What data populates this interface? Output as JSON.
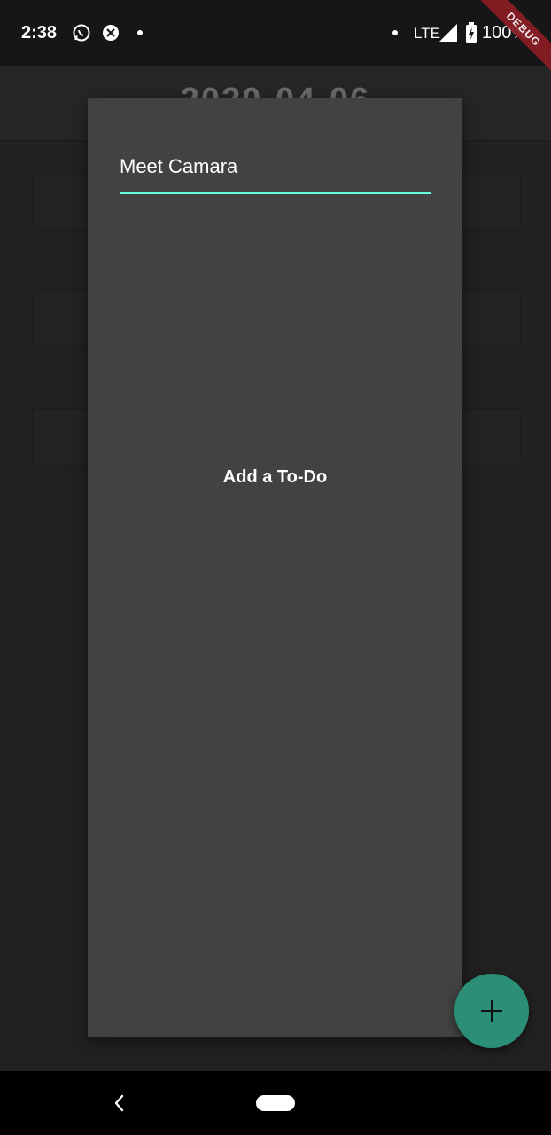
{
  "status_bar": {
    "time": "2:38",
    "network": "LTE",
    "battery": "100%"
  },
  "debug_banner": "DEBUG",
  "background": {
    "title": "2020-04-06"
  },
  "dialog": {
    "input_value": "Meet Camara",
    "action_label": "Add a To-Do",
    "accent_color": "#64ffda"
  },
  "fab": {
    "icon": "plus-icon",
    "color": "#2b8f78"
  },
  "nav": {
    "back_icon": "back-chevron-icon",
    "home_icon": "home-pill-icon"
  }
}
